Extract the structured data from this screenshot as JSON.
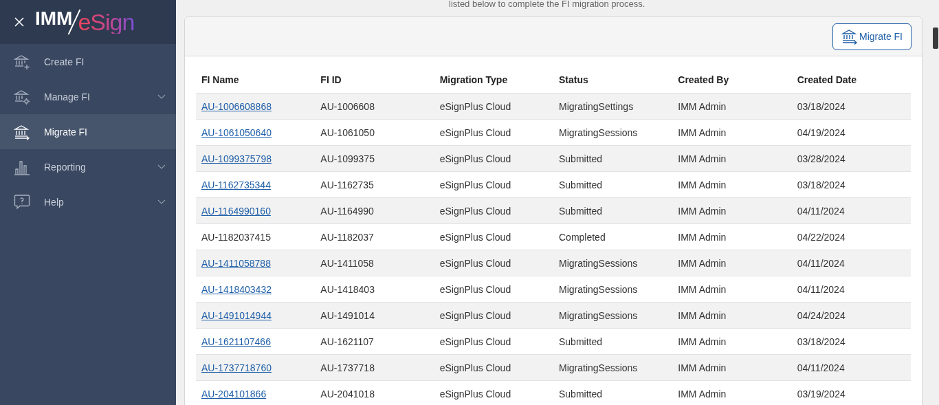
{
  "sidebar": {
    "logo": {
      "left": "IMM",
      "right": "eSign"
    },
    "items": [
      {
        "label": "Create FI",
        "expandable": false,
        "selected": false
      },
      {
        "label": "Manage FI",
        "expandable": true,
        "selected": false
      },
      {
        "label": "Migrate FI",
        "expandable": false,
        "selected": true
      },
      {
        "label": "Reporting",
        "expandable": true,
        "selected": false
      },
      {
        "label": "Help",
        "expandable": true,
        "selected": false
      }
    ]
  },
  "intro": "listed below to complete the FI migration process.",
  "toolbar": {
    "button": "Migrate FI"
  },
  "table": {
    "columns": [
      "FI Name",
      "FI ID",
      "Migration Type",
      "Status",
      "Created By",
      "Created Date"
    ],
    "rows": [
      {
        "linked": true,
        "cells": [
          "AU-1006608868",
          "AU-1006608",
          "eSignPlus Cloud",
          "MigratingSettings",
          "IMM Admin",
          "03/18/2024"
        ]
      },
      {
        "linked": true,
        "cells": [
          "AU-1061050640",
          "AU-1061050",
          "eSignPlus Cloud",
          "MigratingSessions",
          "IMM Admin",
          "04/19/2024"
        ]
      },
      {
        "linked": true,
        "cells": [
          "AU-1099375798",
          "AU-1099375",
          "eSignPlus Cloud",
          "Submitted",
          "IMM Admin",
          "03/28/2024"
        ]
      },
      {
        "linked": true,
        "cells": [
          "AU-1162735344",
          "AU-1162735",
          "eSignPlus Cloud",
          "Submitted",
          "IMM Admin",
          "03/18/2024"
        ]
      },
      {
        "linked": true,
        "cells": [
          "AU-1164990160",
          "AU-1164990",
          "eSignPlus Cloud",
          "Submitted",
          "IMM Admin",
          "04/11/2024"
        ]
      },
      {
        "linked": false,
        "cells": [
          "AU-1182037415",
          "AU-1182037",
          "eSignPlus Cloud",
          "Completed",
          "IMM Admin",
          "04/22/2024"
        ]
      },
      {
        "linked": true,
        "cells": [
          "AU-1411058788",
          "AU-1411058",
          "eSignPlus Cloud",
          "MigratingSessions",
          "IMM Admin",
          "04/11/2024"
        ]
      },
      {
        "linked": true,
        "cells": [
          "AU-1418403432",
          "AU-1418403",
          "eSignPlus Cloud",
          "MigratingSessions",
          "IMM Admin",
          "04/11/2024"
        ]
      },
      {
        "linked": true,
        "cells": [
          "AU-1491014944",
          "AU-1491014",
          "eSignPlus Cloud",
          "MigratingSessions",
          "IMM Admin",
          "04/24/2024"
        ]
      },
      {
        "linked": true,
        "cells": [
          "AU-1621107466",
          "AU-1621107",
          "eSignPlus Cloud",
          "Submitted",
          "IMM Admin",
          "03/18/2024"
        ]
      },
      {
        "linked": true,
        "cells": [
          "AU-1737718760",
          "AU-1737718",
          "eSignPlus Cloud",
          "MigratingSessions",
          "IMM Admin",
          "04/11/2024"
        ]
      },
      {
        "linked": true,
        "cells": [
          "AU-204101866",
          "AU-2041018",
          "eSignPlus Cloud",
          "Submitted",
          "IMM Admin",
          "03/19/2024"
        ]
      }
    ]
  }
}
